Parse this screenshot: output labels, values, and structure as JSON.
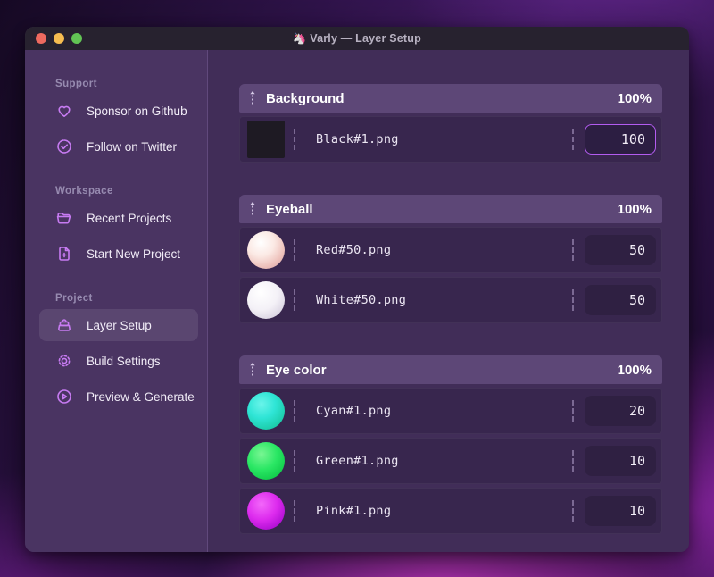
{
  "window": {
    "title": "Varly — Layer Setup",
    "app_icon": "🦄"
  },
  "traffic_lights": {
    "close": "#ee6a5f",
    "minimize": "#f6bd50",
    "zoom": "#62c554"
  },
  "sidebar": {
    "sections": [
      {
        "label": "Support",
        "items": [
          {
            "label": "Sponsor on Github",
            "icon": "heart-icon"
          },
          {
            "label": "Follow on Twitter",
            "icon": "badge-check-icon"
          }
        ]
      },
      {
        "label": "Workspace",
        "items": [
          {
            "label": "Recent Projects",
            "icon": "folder-open-icon"
          },
          {
            "label": "Start New Project",
            "icon": "file-plus-icon"
          }
        ]
      },
      {
        "label": "Project",
        "items": [
          {
            "label": "Layer Setup",
            "icon": "layers-icon",
            "selected": true
          },
          {
            "label": "Build Settings",
            "icon": "gear-icon"
          },
          {
            "label": "Preview & Generate",
            "icon": "play-circle-icon"
          }
        ]
      }
    ]
  },
  "layers": {
    "groups": [
      {
        "name": "Background",
        "weight": "100%",
        "items": [
          {
            "file": "Black#1.png",
            "value": "100",
            "thumb": "black-square"
          }
        ]
      },
      {
        "name": "Eyeball",
        "weight": "100%",
        "items": [
          {
            "file": "Red#50.png",
            "value": "50",
            "thumb": "red-sphere"
          },
          {
            "file": "White#50.png",
            "value": "50",
            "thumb": "white-sphere"
          }
        ]
      },
      {
        "name": "Eye color",
        "weight": "100%",
        "items": [
          {
            "file": "Cyan#1.png",
            "value": "20",
            "thumb": "cyan-sphere"
          },
          {
            "file": "Green#1.png",
            "value": "10",
            "thumb": "green-sphere"
          },
          {
            "file": "Pink#1.png",
            "value": "10",
            "thumb": "pink-sphere"
          }
        ]
      }
    ]
  },
  "colors": {
    "accent": "#b35cf0",
    "icon": "#c77bf2",
    "sidebar_bg": "#4a3462",
    "main_bg": "#412d58",
    "group_header_bg": "#5d4777",
    "row_bg": "#38264e",
    "titlebar_bg": "#27222f"
  }
}
